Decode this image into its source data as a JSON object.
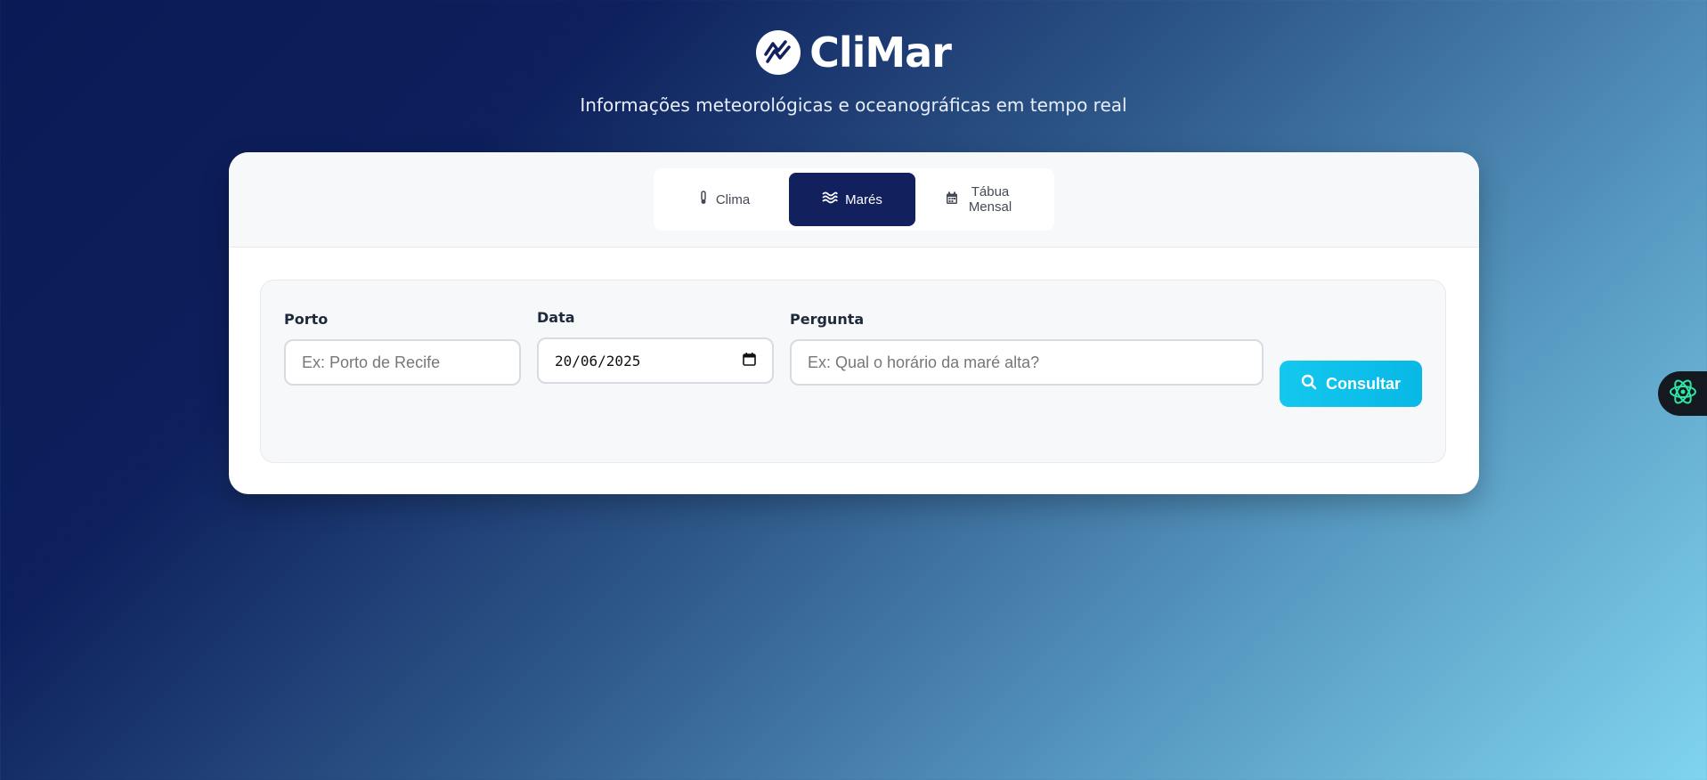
{
  "app": {
    "brand_name": "CliMar",
    "subtitle": "Informações meteorológicas e oceanográficas em tempo real"
  },
  "tabs": [
    {
      "label": "Clima",
      "icon": "thermometer-icon",
      "active": false
    },
    {
      "label": "Marés",
      "icon": "waves-icon",
      "active": true
    },
    {
      "label_line1": "Tábua",
      "label_line2": "Mensal",
      "icon": "calendar-icon",
      "active": false
    }
  ],
  "form": {
    "porto": {
      "label": "Porto",
      "placeholder": "Ex: Porto de Recife",
      "value": ""
    },
    "data": {
      "label": "Data",
      "value": "20/06/2025",
      "icon": "calendar-icon"
    },
    "pergunta": {
      "label": "Pergunta",
      "placeholder": "Ex: Qual o horário da maré alta?",
      "value": ""
    },
    "submit": {
      "label": "Consultar",
      "icon": "search-icon"
    }
  },
  "side_widget": {
    "icon": "assistant-icon"
  },
  "colors": {
    "active_tab": "#12205e",
    "accent": "#13c8ef",
    "widget_bg": "#14181f",
    "widget_icon": "#2ee6a6"
  }
}
